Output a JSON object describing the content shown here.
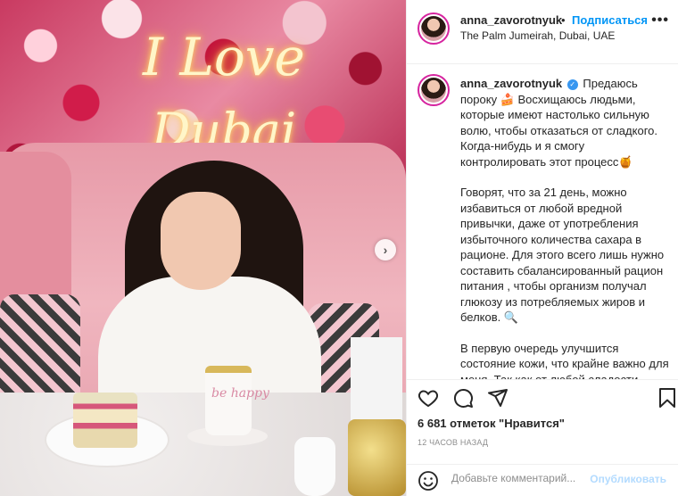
{
  "post": {
    "photo_overlay": {
      "neon_line1": "I Love",
      "neon_line2": "Dubai",
      "cup_text": "be happy",
      "next_glyph": "›"
    }
  },
  "header": {
    "username": "anna_zavorotnyuk",
    "separator": "•",
    "follow_label": "Подписаться",
    "location": "The Palm Jumeirah, Dubai, UAE",
    "more_glyph": "•••"
  },
  "caption": {
    "username": "anna_zavorotnyuk",
    "verified_glyph": "✓",
    "p1a": "Предаюсь пороку",
    "emoji_cake": "🍰",
    "p1b": "Восхищаюсь людьми, которые имеют настолько сильную волю, чтобы отказаться от сладкого. Когда-нибудь и я смогу контролировать этот процесс",
    "emoji_honey": "🍯",
    "p2": "Говорят, что за 21 день, можно избавиться от любой вредной привычки, даже от употребления избыточного количества сахара в рационе. Для этого всего лишь нужно составить сбалансированный рацион питания , чтобы организм получал глюкозу из потребляемых жиров и белков.",
    "emoji_magnifier": "🔍",
    "p3": "В первую очередь улучшится состояние кожи, что крайне важно для меня. Так как от любой сладости"
  },
  "actions": {
    "icons": [
      "heart-icon",
      "comment-icon",
      "share-icon",
      "bookmark-icon"
    ]
  },
  "stats": {
    "likes": "6 681 отметок \"Нравится\"",
    "time_ago": "12 ЧАСОВ НАЗАД"
  },
  "comment": {
    "placeholder": "Добавьте комментарий...",
    "publish_label": "Опубликовать",
    "emoji_icon": "smiley-icon"
  },
  "colors": {
    "accent": "#0095f6",
    "publish_disabled": "#b3dbff",
    "story_ring": "#d6249f"
  }
}
